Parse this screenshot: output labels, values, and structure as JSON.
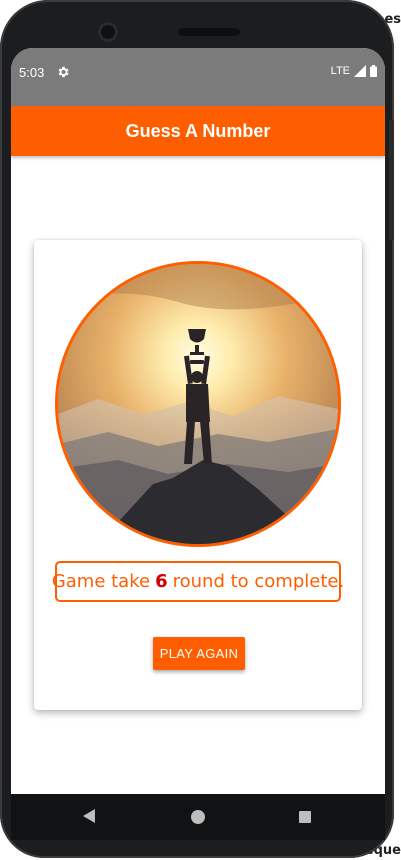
{
  "background_fragments": {
    "top_right": "es",
    "bottom_right": "eque"
  },
  "status_bar": {
    "time": "5:03",
    "network": "LTE",
    "icons": [
      "settings-icon",
      "signal-icon",
      "battery-icon"
    ]
  },
  "app_bar": {
    "title": "Guess A Number"
  },
  "game_over": {
    "image": "trophy-on-mountain-sunset",
    "result_prefix": "Game take",
    "round_count": "6",
    "result_suffix": "round to complete.",
    "play_again_label": "PLAY AGAIN"
  },
  "nav_bar": {
    "icons": [
      "back-icon",
      "home-icon",
      "recent-apps-icon"
    ]
  },
  "colors": {
    "primary": "#ff5e00",
    "accent_round": "#d40000",
    "status_bar": "#7b7b7b"
  }
}
